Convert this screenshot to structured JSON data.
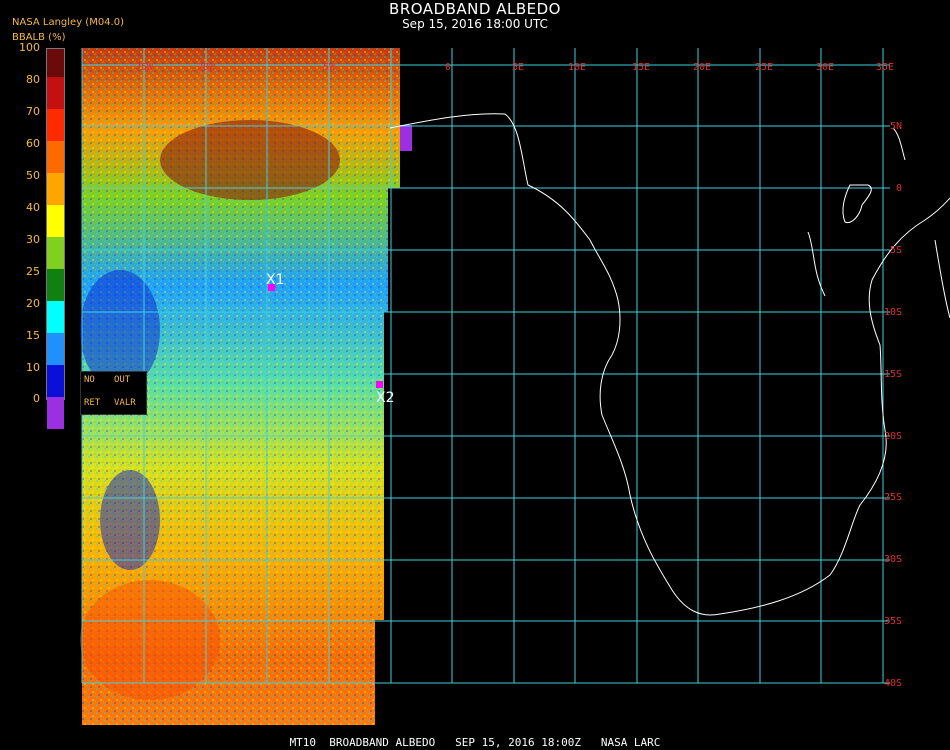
{
  "header": {
    "title": "BROADBAND ALBEDO",
    "subtitle": "Sep 15, 2016 18:00 UTC",
    "source": "NASA Langley (M04.0)"
  },
  "colorbar": {
    "label": "BBALB (%)",
    "ticks": [
      "100",
      "80",
      "70",
      "60",
      "50",
      "40",
      "30",
      "25",
      "20",
      "15",
      "10",
      "0"
    ],
    "colors": [
      "#6a0a0a",
      "#c41010",
      "#ff2a00",
      "#ff6a00",
      "#ffa500",
      "#ffff00",
      "#80d020",
      "#108010",
      "#00ffff",
      "#2090ff",
      "#0a10d8",
      "#9a30e0"
    ]
  },
  "map": {
    "lon_labels": [
      "25W",
      "20W",
      "5W",
      "0",
      "5E",
      "10E",
      "15E",
      "20E",
      "25E",
      "30E",
      "35E"
    ],
    "lat_labels": [
      "5N",
      "0",
      "5S",
      "10S",
      "15S",
      "20S",
      "25S",
      "30S",
      "35S",
      "40S"
    ],
    "grid_color": "#40d0e0",
    "label_color": "#e03030",
    "markers": [
      {
        "label": "X1",
        "color": "#ff00ff"
      },
      {
        "label": "X2",
        "color": "#ff00ff"
      }
    ]
  },
  "legend_box": {
    "items": [
      "NO",
      "OUT",
      "RET",
      "VALR"
    ]
  },
  "footer": "MT10  BROADBAND ALBEDO   SEP 15, 2016 18:00Z   NASA LARC"
}
